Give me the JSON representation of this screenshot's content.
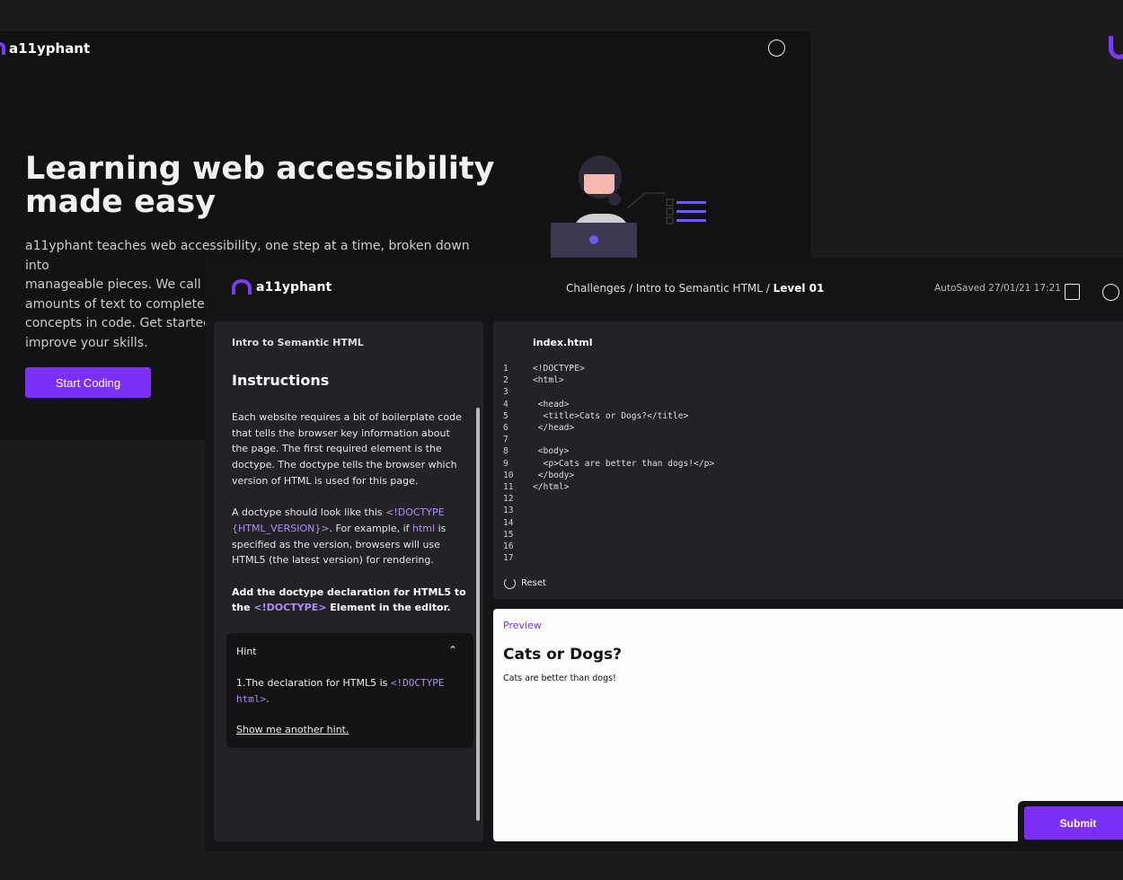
{
  "background_page": {
    "logo": "a11yphant",
    "title_lines": [
      "Learning web accessibility",
      "made easy"
    ],
    "description_lines": [
      "a11yphant teaches web accessibility, one step at a time, broken down into",
      "manageable pieces. We call th",
      "amounts of text to complete th",
      "concepts in code. Get started v",
      "improve your skills."
    ],
    "start_button": "Start Coding"
  },
  "app": {
    "logo": "a11yphant",
    "breadcrumb": {
      "part1": "Challenges",
      "sep": " / ",
      "part2": "Intro to Semantic HTML",
      "part3": "Level 01"
    },
    "autosave": "AutoSaved 27/01/21 17:21"
  },
  "instructions": {
    "subtitle": "Intro to Semantic HTML",
    "heading": "Instructions",
    "p1": "Each website requires a bit of boilerplate code that tells the browser key information about the page. The first required element is the doctype. The doctype tells the browser which version of HTML is used for this page.",
    "p2a": "A doctype should look like this ",
    "p2code": "<!DOCTYPE {HTML_VERSION}>",
    "p2b": ". For example, if ",
    "p2html": "html",
    "p2c": " is specified as the version, browsers will use HTML5 (the latest version) for rendering.",
    "p3a": "Add the doctype declaration for HTML5 to the ",
    "p3code": "<!DOCTYPE>",
    "p3b": " Element in the editor."
  },
  "hint": {
    "title": "Hint",
    "text": "1.The declaration for HTML5 is ",
    "code": "<!DOCTYPE html>",
    "end": ".",
    "link": "Show me another hint."
  },
  "editor": {
    "filename": "index.html",
    "lines": [
      "<!DOCTYPE>",
      "<html>",
      "",
      " <head>",
      "  <title>Cats or Dogs?</title>",
      " </head>",
      "",
      " <body>",
      "  <p>Cats are better than dogs!</p>",
      " </body>",
      "</html>",
      "",
      "",
      "",
      "",
      "",
      ""
    ],
    "reset": "Reset"
  },
  "preview": {
    "label": "Preview",
    "heading": "Cats or Dogs?",
    "text": "Cats are better than dogs!"
  },
  "submit": "Submit",
  "colors": {
    "accent": "#7b2ff7",
    "code_tag": "#b08cf5"
  }
}
